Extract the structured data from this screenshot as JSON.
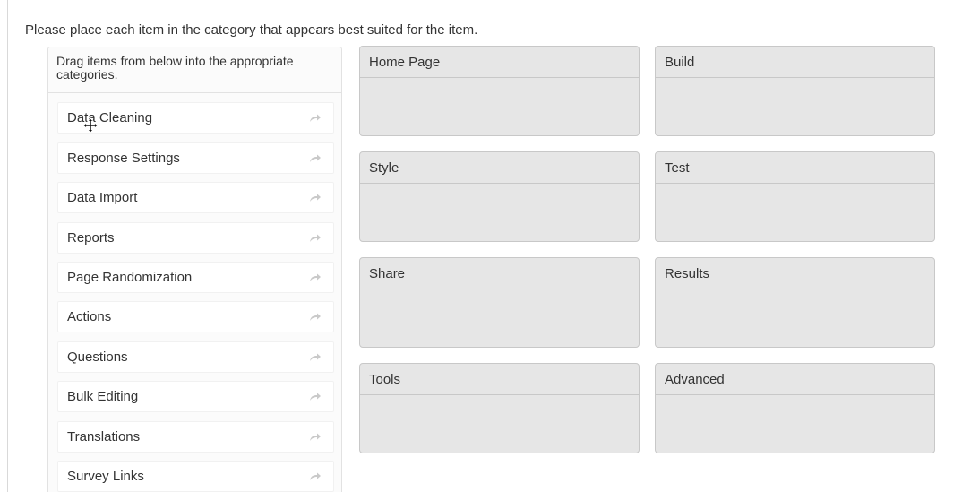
{
  "instruction": "Please place each item in the category that appears best suited for the item.",
  "source": {
    "header": "Drag items from below into the appropriate categories.",
    "items": [
      {
        "label": "Data Cleaning"
      },
      {
        "label": "Response Settings"
      },
      {
        "label": "Data Import"
      },
      {
        "label": "Reports"
      },
      {
        "label": "Page Randomization"
      },
      {
        "label": "Actions"
      },
      {
        "label": "Questions"
      },
      {
        "label": "Bulk Editing"
      },
      {
        "label": "Translations"
      },
      {
        "label": "Survey Links"
      }
    ]
  },
  "categories": [
    {
      "label": "Home Page"
    },
    {
      "label": "Build"
    },
    {
      "label": "Style"
    },
    {
      "label": "Test"
    },
    {
      "label": "Share"
    },
    {
      "label": "Results"
    },
    {
      "label": "Tools"
    },
    {
      "label": "Advanced"
    }
  ],
  "icons": {
    "item_arrow": "arrow-forward-icon",
    "cursor": "move-cursor-icon"
  },
  "colors": {
    "category_bg": "#e6e6e6",
    "category_border": "#c8c8c8",
    "arrow": "#c9c9c9"
  }
}
